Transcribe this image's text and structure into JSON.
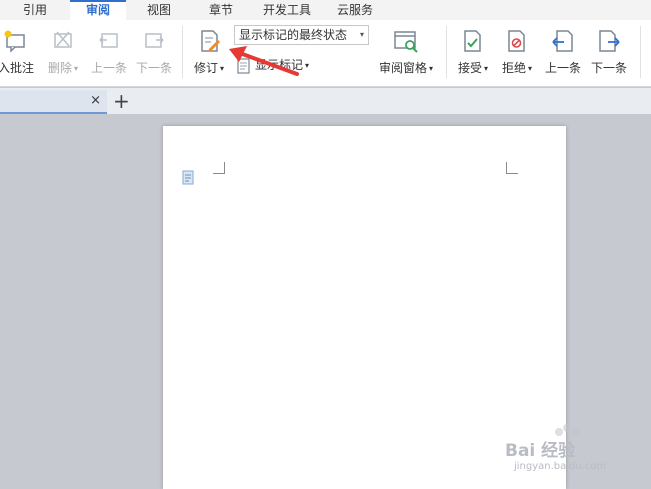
{
  "menu": {
    "tabs": [
      {
        "label": "引用"
      },
      {
        "label": "审阅",
        "active": true
      },
      {
        "label": "视图"
      },
      {
        "label": "章节"
      },
      {
        "label": "开发工具"
      },
      {
        "label": "云服务"
      }
    ]
  },
  "ribbon": {
    "insert_comment": "入批注",
    "delete": "删除",
    "prev_comment": "上一条",
    "next_comment": "下一条",
    "track_changes": "修订",
    "markup_mode": "显示标记的最终状态",
    "show_markup": "显示标记",
    "review_pane": "审阅窗格",
    "accept": "接受",
    "reject": "拒绝",
    "prev_change": "上一条",
    "next_change": "下一条"
  },
  "doc_tabs": {
    "close_symbol": "×",
    "add_symbol": "+"
  },
  "colors": {
    "accent": "#2f6fcf",
    "arrow": "#e53935",
    "workspace": "#c7c9d1"
  },
  "watermark": {
    "brand": "Bai 经验",
    "url": "jingyan.baidu.com"
  }
}
